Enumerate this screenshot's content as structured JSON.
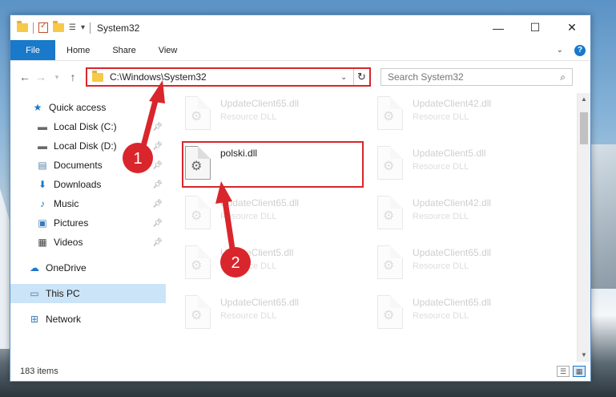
{
  "window": {
    "title": "System32"
  },
  "controls": {
    "minimize": "—",
    "maximize": "☐",
    "close": "✕"
  },
  "ribbon": {
    "file": "File",
    "tabs": [
      "Home",
      "Share",
      "View"
    ]
  },
  "address": {
    "path": "C:\\Windows\\System32",
    "search_placeholder": "Search System32"
  },
  "nav": {
    "items": [
      {
        "label": "Quick access",
        "icon": "star-icon"
      },
      {
        "label": "Local Disk (C:)",
        "icon": "drive-icon",
        "pinned": true
      },
      {
        "label": "Local Disk (D:)",
        "icon": "drive-icon",
        "pinned": true
      },
      {
        "label": "Documents",
        "icon": "documents-icon",
        "pinned": true
      },
      {
        "label": "Downloads",
        "icon": "downloads-icon",
        "pinned": true
      },
      {
        "label": "Music",
        "icon": "music-icon",
        "pinned": true
      },
      {
        "label": "Pictures",
        "icon": "pictures-icon",
        "pinned": true
      },
      {
        "label": "Videos",
        "icon": "videos-icon",
        "pinned": true
      },
      {
        "label": "OneDrive",
        "icon": "onedrive-icon"
      },
      {
        "label": "This PC",
        "icon": "computer-icon",
        "selected": true
      },
      {
        "label": "Network",
        "icon": "network-icon"
      }
    ]
  },
  "files": [
    {
      "name": "UpdateClient65.dll",
      "type": "Resource DLL",
      "faded": true
    },
    {
      "name": "UpdateClient42.dll",
      "type": "Resource DLL",
      "faded": true
    },
    {
      "name": "polski.dll",
      "type": "",
      "faded": false,
      "highlighted": true
    },
    {
      "name": "UpdateClient5.dll",
      "type": "Resource DLL",
      "faded": true
    },
    {
      "name": "UpdateClient65.dll",
      "type": "Resource DLL",
      "faded": true
    },
    {
      "name": "UpdateClient42.dll",
      "type": "Resource DLL",
      "faded": true
    },
    {
      "name": "UpdateClient5.dll",
      "type": "Resource DLL",
      "faded": true
    },
    {
      "name": "UpdateClient65.dll",
      "type": "Resource DLL",
      "faded": true
    },
    {
      "name": "UpdateClient65.dll",
      "type": "Resource DLL",
      "faded": true
    },
    {
      "name": "UpdateClient65.dll",
      "type": "Resource DLL",
      "faded": true
    }
  ],
  "status": {
    "count": "183 items"
  },
  "annotations": {
    "step1": "1",
    "step2": "2"
  },
  "colors": {
    "accent": "#1979ca",
    "highlight": "#d9262c",
    "selection": "#cce4f7"
  }
}
